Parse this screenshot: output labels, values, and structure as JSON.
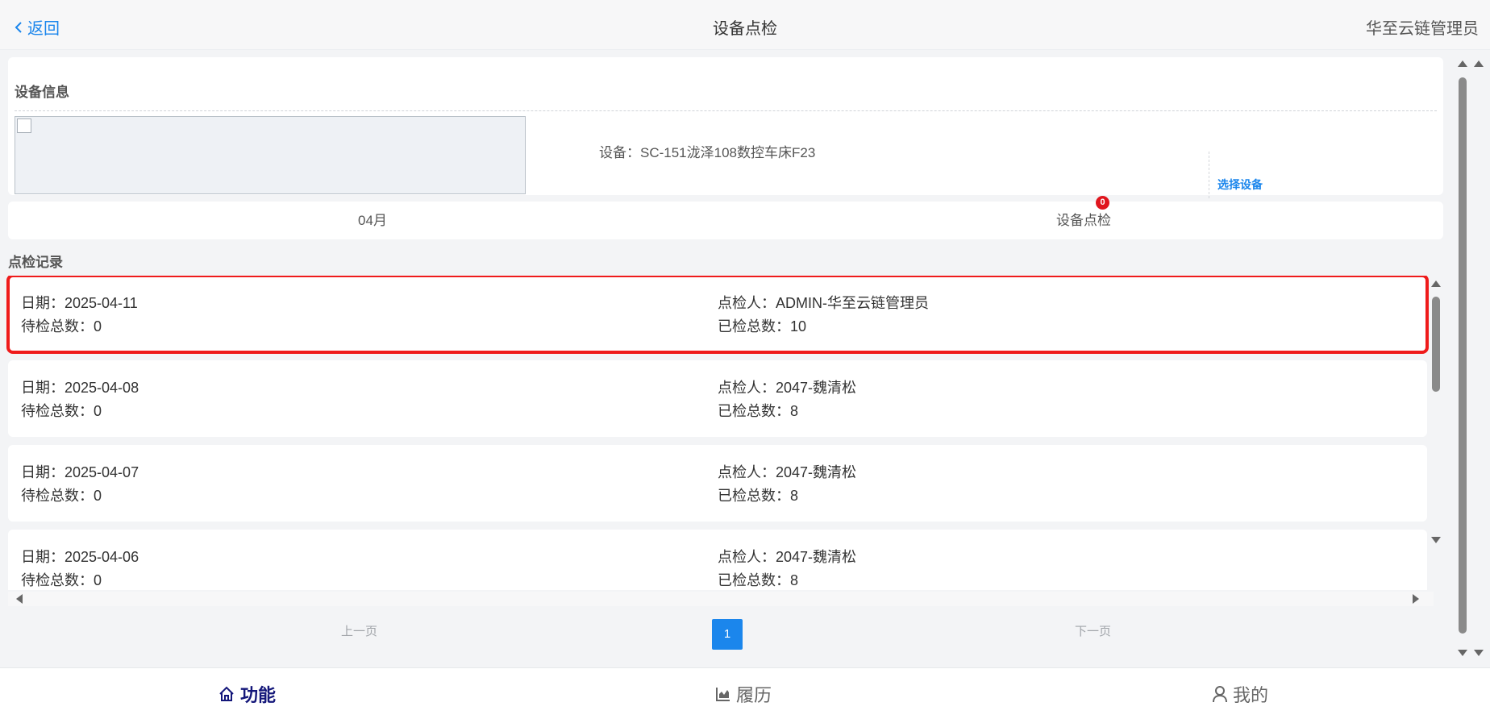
{
  "header": {
    "back_label": "返回",
    "title": "设备点检",
    "user": "华至云链管理员"
  },
  "device_info": {
    "section_title": "设备信息",
    "device_text": "设备：SC-151泷泽108数控车床F23",
    "select_label": "选择设备"
  },
  "tabs": {
    "month": "04月",
    "inspection": "设备点检",
    "badge": "0"
  },
  "records": {
    "section_title": "点检记录",
    "items": [
      {
        "date": "日期：2025-04-11",
        "inspector": "点检人：ADMIN-华至云链管理员",
        "pending": "待检总数：0",
        "done": "已检总数：10"
      },
      {
        "date": "日期：2025-04-08",
        "inspector": "点检人：2047-魏清松",
        "pending": "待检总数：0",
        "done": "已检总数：8"
      },
      {
        "date": "日期：2025-04-07",
        "inspector": "点检人：2047-魏清松",
        "pending": "待检总数：0",
        "done": "已检总数：8"
      },
      {
        "date": "日期：2025-04-06",
        "inspector": "点检人：2047-魏清松",
        "pending": "待检总数：0",
        "done": "已检总数：8"
      }
    ]
  },
  "pager": {
    "prev": "上一页",
    "current": "1",
    "next": "下一页"
  },
  "bottom_nav": {
    "items": [
      {
        "label": "功能",
        "icon": "home-icon"
      },
      {
        "label": "履历",
        "icon": "chart-icon"
      },
      {
        "label": "我的",
        "icon": "user-icon"
      }
    ]
  },
  "colors": {
    "accent": "#1b86ec",
    "selection": "#ef1b1b",
    "badge": "#e0161e",
    "nav_active": "#14177a"
  }
}
